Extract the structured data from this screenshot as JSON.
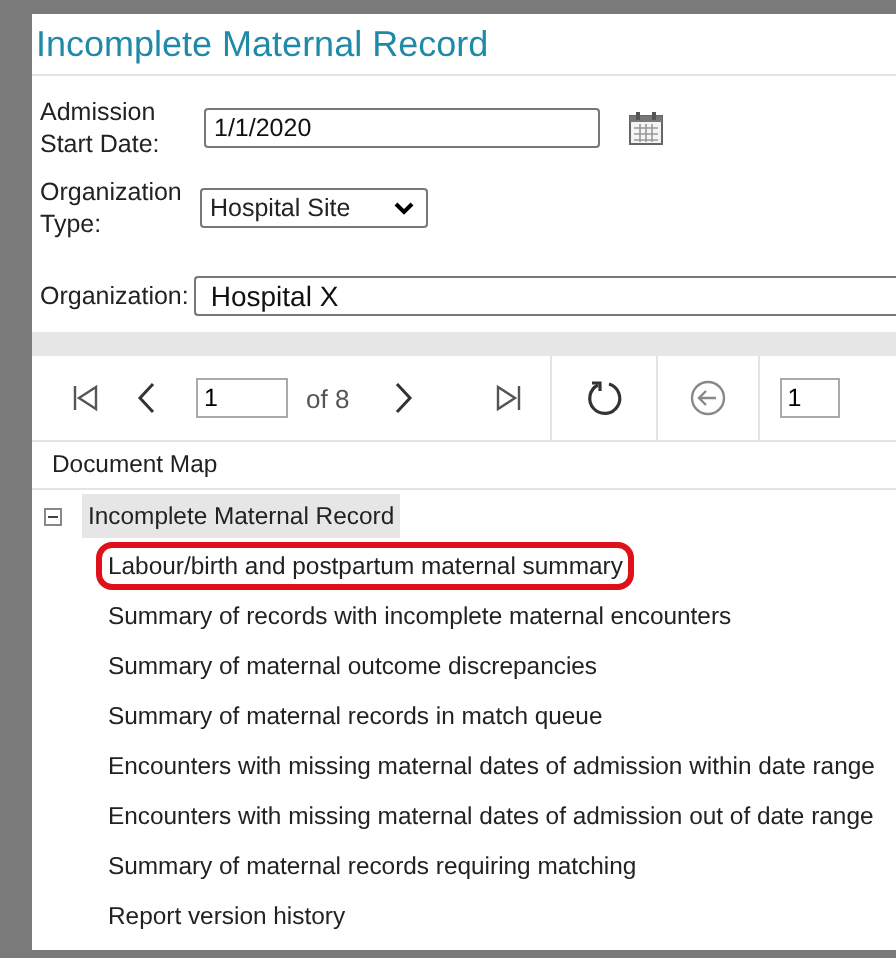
{
  "title": "Incomplete Maternal Record",
  "form": {
    "admission_label": "Admission Start Date:",
    "admission_value": "1/1/2020",
    "org_type_label": "Organization Type:",
    "org_type_value": "Hospital Site",
    "org_label": "Organization:",
    "org_value": "Hospital X"
  },
  "toolbar": {
    "page_value": "1",
    "page_count": "of 8",
    "field_2_value": "1"
  },
  "document_map": {
    "header": "Document Map",
    "root": {
      "label": "Incomplete Maternal Record",
      "expanded": true,
      "selected": true,
      "children": [
        {
          "label": "Labour/birth and postpartum maternal summary",
          "circled": true
        },
        {
          "label": "Summary of records with incomplete maternal encounters",
          "circled": false
        },
        {
          "label": "Summary of maternal outcome discrepancies",
          "circled": false
        },
        {
          "label": "Summary of maternal records in match queue",
          "circled": false
        },
        {
          "label": "Encounters with missing maternal dates of admission within date range",
          "circled": false
        },
        {
          "label": "Encounters with missing maternal dates of admission out of date range",
          "circled": false
        },
        {
          "label": "Summary of maternal records requiring matching",
          "circled": false
        },
        {
          "label": "Report version history",
          "circled": false
        }
      ]
    }
  }
}
